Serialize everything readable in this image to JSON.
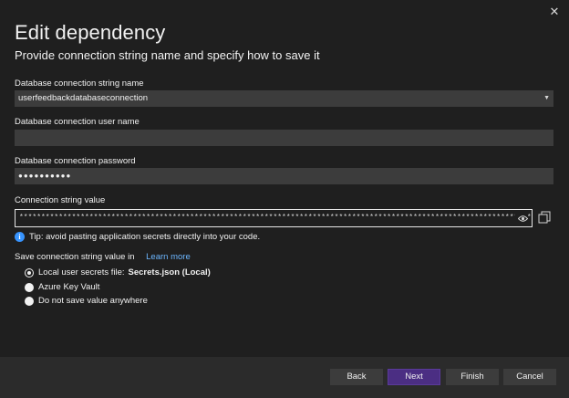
{
  "dialog": {
    "close_glyph": "✕",
    "title": "Edit dependency",
    "subtitle": "Provide connection string name and specify how to save it"
  },
  "fields": {
    "conn_name_label": "Database connection string name",
    "conn_name_value": "userfeedbackdatabaseconnection",
    "user_label": "Database connection user name",
    "user_value": "",
    "password_label": "Database connection password",
    "password_value": "●●●●●●●●●●",
    "conn_value_label": "Connection string value",
    "conn_value": "**************************************************************************************************************************************************"
  },
  "tip": {
    "icon": "i",
    "text": "Tip: avoid pasting application secrets directly into your code."
  },
  "save": {
    "label": "Save connection string value in",
    "learn_more": "Learn more",
    "options": [
      {
        "label": "Local user secrets file:",
        "value": "Secrets.json (Local)",
        "selected": true
      },
      {
        "label": "Azure Key Vault",
        "value": "",
        "selected": false
      },
      {
        "label": "Do not save value anywhere",
        "value": "",
        "selected": false
      }
    ]
  },
  "buttons": {
    "back": "Back",
    "next": "Next",
    "finish": "Finish",
    "cancel": "Cancel"
  },
  "colors": {
    "background": "#1f1f1f",
    "input": "#3c3c3c",
    "primary_button": "#4b2e83",
    "link": "#6cb6ff",
    "info": "#3794ff"
  }
}
